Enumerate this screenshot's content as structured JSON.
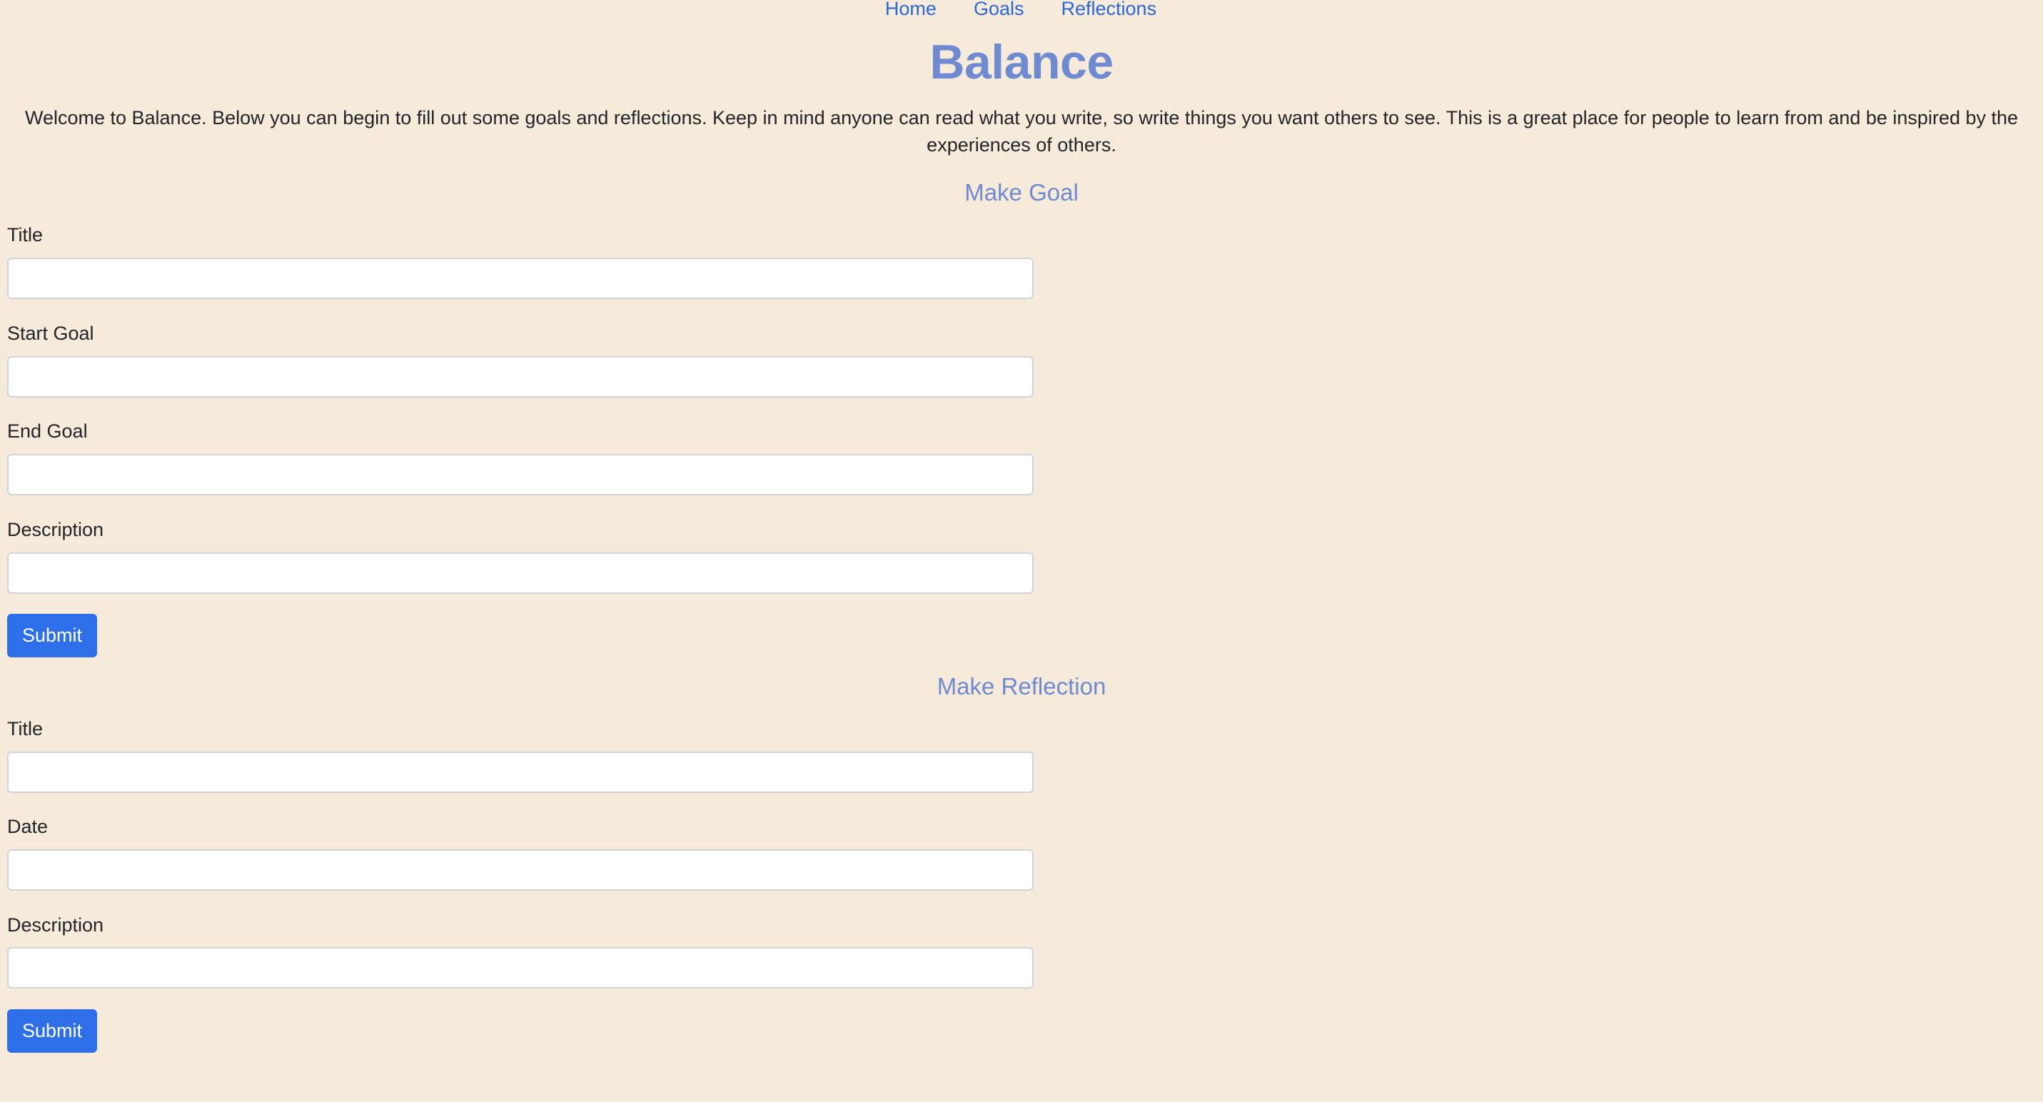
{
  "nav": {
    "items": [
      {
        "label": "Home"
      },
      {
        "label": "Goals"
      },
      {
        "label": "Reflections"
      }
    ]
  },
  "header": {
    "title": "Balance"
  },
  "intro": {
    "text": "Welcome to Balance. Below you can begin to fill out some goals and reflections. Keep in mind anyone can read what you write, so write things you want others to see. This is a great place for people to learn from and be inspired by the experiences of others."
  },
  "goal_form": {
    "heading": "Make Goal",
    "fields": [
      {
        "label": "Title",
        "value": "",
        "placeholder": ""
      },
      {
        "label": "Start Goal",
        "value": "",
        "placeholder": ""
      },
      {
        "label": "End Goal",
        "value": "",
        "placeholder": ""
      },
      {
        "label": "Description",
        "value": "",
        "placeholder": ""
      }
    ],
    "submit_label": "Submit"
  },
  "reflection_form": {
    "heading": "Make Reflection",
    "fields": [
      {
        "label": "Title",
        "value": "",
        "placeholder": ""
      },
      {
        "label": "Date",
        "value": "",
        "placeholder": ""
      },
      {
        "label": "Description",
        "value": "",
        "placeholder": ""
      }
    ],
    "submit_label": "Submit"
  },
  "colors": {
    "background": "#f6ebda",
    "heading": "#6f8ad0",
    "link": "#2968d6",
    "button": "#2e6fe9"
  }
}
